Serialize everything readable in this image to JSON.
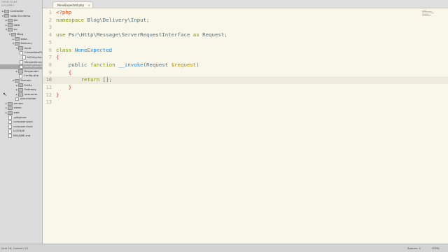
{
  "sidebar": {
    "open_files_label": "OPEN FILES",
    "folders_label": "FOLDERS",
    "items": [
      {
        "label": "Controller",
        "kind": "folder",
        "depth": 0,
        "expanded": false
      },
      {
        "label": "radar-fsr-demo",
        "kind": "folder",
        "depth": 0,
        "expanded": true
      },
      {
        "label": "bin",
        "kind": "folder",
        "depth": 1,
        "expanded": false
      },
      {
        "label": "data",
        "kind": "folder",
        "depth": 1,
        "expanded": false
      },
      {
        "label": "src",
        "kind": "folder",
        "depth": 1,
        "expanded": true
      },
      {
        "label": "Blog",
        "kind": "folder",
        "depth": 2,
        "expanded": true
      },
      {
        "label": "Data",
        "kind": "folder",
        "depth": 3,
        "expanded": false
      },
      {
        "label": "Delivery",
        "kind": "folder",
        "depth": 3,
        "expanded": true
      },
      {
        "label": "Input",
        "kind": "folder",
        "depth": 4,
        "expanded": true
      },
      {
        "label": "CreateNewPost.php",
        "kind": "file",
        "depth": 5
      },
      {
        "label": "IdOnly.php",
        "kind": "file",
        "depth": 5
      },
      {
        "label": "MergedArray.php",
        "kind": "file",
        "depth": 5
      },
      {
        "label": "NoneExpected.php",
        "kind": "file",
        "depth": 5,
        "selected": true
      },
      {
        "label": "Responder",
        "kind": "folder",
        "depth": 4,
        "expanded": false
      },
      {
        "label": "Config.php",
        "kind": "file",
        "depth": 4
      },
      {
        "label": "Domain",
        "kind": "folder",
        "depth": 3,
        "expanded": true
      },
      {
        "label": "Entity",
        "kind": "folder",
        "depth": 4,
        "expanded": false
      },
      {
        "label": "Gateway",
        "kind": "folder",
        "depth": 4,
        "expanded": false
      },
      {
        "label": "Interactor",
        "kind": "folder",
        "depth": 4,
        "expanded": false
      },
      {
        "label": "placeholder",
        "kind": "file",
        "depth": 3
      },
      {
        "label": "vendor",
        "kind": "folder",
        "depth": 1,
        "expanded": false
      },
      {
        "label": "views",
        "kind": "folder",
        "depth": 1,
        "expanded": false
      },
      {
        "label": "web",
        "kind": "folder",
        "depth": 1,
        "expanded": false
      },
      {
        "label": ".gitignore",
        "kind": "file",
        "depth": 1
      },
      {
        "label": "composer.json",
        "kind": "file",
        "depth": 1
      },
      {
        "label": "composer.lock",
        "kind": "file",
        "depth": 1
      },
      {
        "label": "LICENSE",
        "kind": "file",
        "depth": 1
      },
      {
        "label": "README.md",
        "kind": "file",
        "depth": 1
      }
    ]
  },
  "tab": {
    "label": "NoneExpected.php",
    "close": "×"
  },
  "editor": {
    "active_line": 10,
    "lines": [
      {
        "n": "1",
        "tokens": [
          {
            "t": "<?php",
            "c": "tag"
          }
        ]
      },
      {
        "n": "2",
        "tokens": [
          {
            "t": "namespace ",
            "c": "kw"
          },
          {
            "t": "Blog\\Delivery\\Input;",
            "c": "ns"
          }
        ]
      },
      {
        "n": "3",
        "tokens": []
      },
      {
        "n": "4",
        "tokens": [
          {
            "t": "use ",
            "c": "kw"
          },
          {
            "t": "Psr\\Http\\Message\\ServerRequestInterface ",
            "c": "ns"
          },
          {
            "t": "as ",
            "c": "kw"
          },
          {
            "t": "Request;",
            "c": "ns"
          }
        ]
      },
      {
        "n": "5",
        "tokens": []
      },
      {
        "n": "6",
        "tokens": [
          {
            "t": "class ",
            "c": "kw"
          },
          {
            "t": "NoneExpected",
            "c": "cls"
          }
        ]
      },
      {
        "n": "7",
        "tokens": [
          {
            "t": "{",
            "c": "br"
          }
        ]
      },
      {
        "n": "8",
        "tokens": [
          {
            "t": "    public ",
            "c": "pl"
          },
          {
            "t": "function ",
            "c": "kw"
          },
          {
            "t": "__invoke",
            "c": "fn"
          },
          {
            "t": "(Request ",
            "c": "pl"
          },
          {
            "t": "$request",
            "c": "var"
          },
          {
            "t": ")",
            "c": "pl"
          }
        ]
      },
      {
        "n": "9",
        "tokens": [
          {
            "t": "    {",
            "c": "br"
          }
        ]
      },
      {
        "n": "10",
        "tokens": [
          {
            "t": "        return ",
            "c": "kw"
          },
          {
            "t": "[];",
            "c": "pl"
          }
        ]
      },
      {
        "n": "11",
        "tokens": [
          {
            "t": "    }",
            "c": "br"
          }
        ]
      },
      {
        "n": "12",
        "tokens": [
          {
            "t": "}",
            "c": "br"
          }
        ]
      },
      {
        "n": "13",
        "tokens": []
      }
    ]
  },
  "status": {
    "position": "Line 10, Column 13",
    "indent": "Spaces: 4",
    "syntax": "HTML"
  },
  "colors": {
    "editor_bg": "#f9f6ea",
    "keyword": "#859900",
    "class": "#268bd2",
    "variable": "#b58900",
    "bracket": "#dc322f",
    "tag": "#cb4b16"
  }
}
